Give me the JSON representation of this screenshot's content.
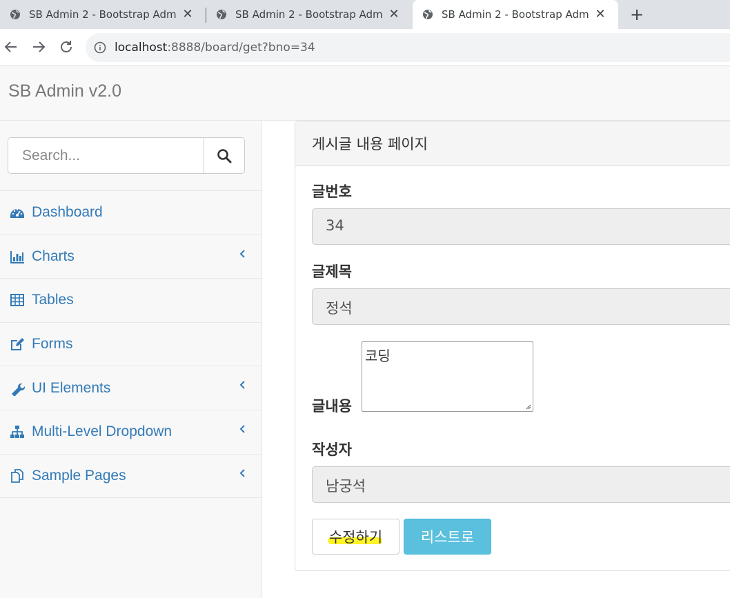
{
  "browser": {
    "tabs": [
      {
        "title": "SB Admin 2 - Bootstrap Admin Theme",
        "active": false
      },
      {
        "title": "SB Admin 2 - Bootstrap Admin Theme",
        "active": false
      },
      {
        "title": "SB Admin 2 - Bootstrap Admin Theme",
        "active": true
      }
    ],
    "new_tab_label": "+",
    "url_host": "localhost",
    "url_path": ":8888/board/get?bno=34"
  },
  "header": {
    "brand": "SB Admin v2.0"
  },
  "sidebar": {
    "search_placeholder": "Search...",
    "items": [
      {
        "label": "Dashboard",
        "icon": "dashboard-icon",
        "has_submenu": false
      },
      {
        "label": "Charts",
        "icon": "bar-chart-icon",
        "has_submenu": true
      },
      {
        "label": "Tables",
        "icon": "table-icon",
        "has_submenu": false
      },
      {
        "label": "Forms",
        "icon": "edit-icon",
        "has_submenu": false
      },
      {
        "label": "UI Elements",
        "icon": "wrench-icon",
        "has_submenu": true
      },
      {
        "label": "Multi-Level Dropdown",
        "icon": "sitemap-icon",
        "has_submenu": true
      },
      {
        "label": "Sample Pages",
        "icon": "files-icon",
        "has_submenu": true
      }
    ]
  },
  "panel": {
    "heading": "게시글 내용 페이지",
    "bno_label": "글번호",
    "bno_value": "34",
    "title_label": "글제목",
    "title_value": "정석",
    "content_label": "글내용",
    "content_value": "코딩",
    "writer_label": "작성자",
    "writer_value": "남궁석",
    "modify_button": "수정하기",
    "list_button": "리스트로"
  },
  "colors": {
    "link": "#337ab7",
    "info_button": "#5bc0de",
    "highlight": "#fff200"
  }
}
